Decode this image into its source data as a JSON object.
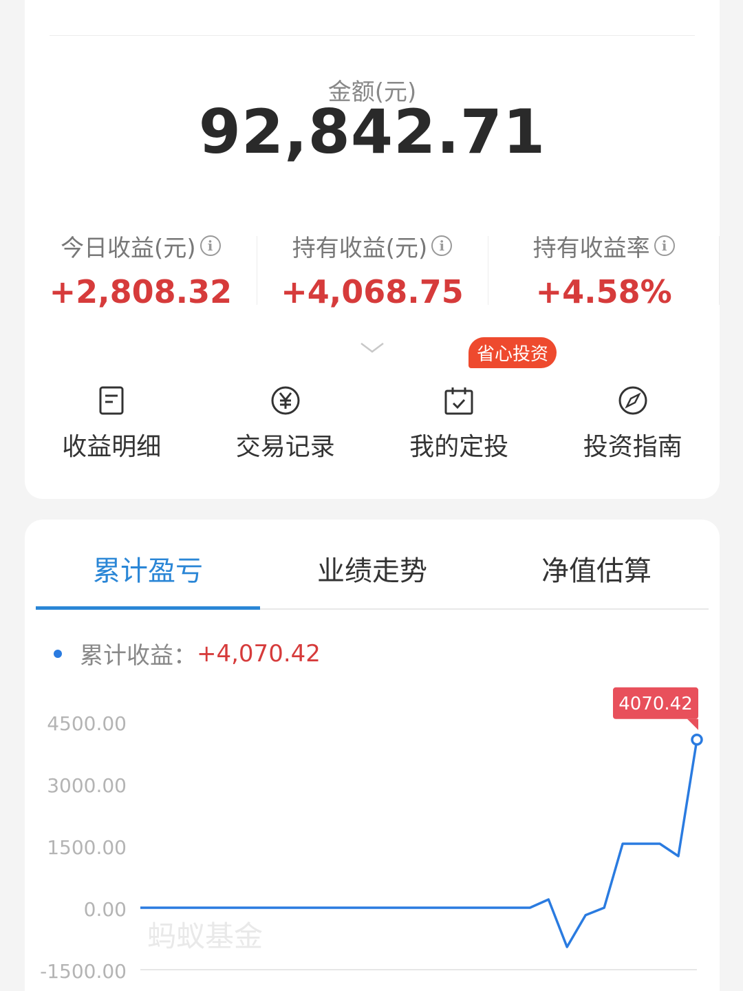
{
  "summary": {
    "amount_label": "金额(元)",
    "amount_value": "92,842.71",
    "stats": [
      {
        "label": "今日收益(元)",
        "value": "+2,808.32"
      },
      {
        "label": "持有收益(元)",
        "value": "+4,068.75"
      },
      {
        "label": "持有收益率",
        "value": "+4.58%"
      }
    ],
    "info_glyph": "i"
  },
  "actions": [
    {
      "label": "收益明细",
      "icon": "document-icon"
    },
    {
      "label": "交易记录",
      "icon": "yen-circle-icon"
    },
    {
      "label": "我的定投",
      "icon": "calendar-check-icon",
      "badge": "省心投资"
    },
    {
      "label": "投资指南",
      "icon": "compass-icon"
    }
  ],
  "tabs": [
    {
      "label": "累计盈亏",
      "active": true
    },
    {
      "label": "业绩走势",
      "active": false
    },
    {
      "label": "净值估算",
      "active": false
    }
  ],
  "legend": {
    "label": "累计收益：",
    "value": "+4,070.42"
  },
  "watermark": "蚂蚁基金",
  "colors": {
    "accent": "#2a86d6",
    "line": "#2a7be0",
    "positive": "#d63b3b",
    "tooltip": "#e8505b",
    "badge": "#ee4a2e"
  },
  "chart_data": {
    "type": "line",
    "series": [
      {
        "values": [
          0,
          0,
          0,
          0,
          0,
          0,
          0,
          0,
          0,
          0,
          0,
          0,
          0,
          0,
          0,
          0,
          0,
          0,
          0,
          0,
          0,
          0,
          200,
          -950,
          -180,
          0,
          1550,
          1550,
          1550,
          1250,
          4070.42
        ]
      }
    ],
    "ylim": [
      -1500,
      4500
    ],
    "yticks": [
      "4500.00",
      "3000.00",
      "1500.00",
      "0.00",
      "-1500.00"
    ],
    "tooltip": "4070.42",
    "grid": false
  }
}
